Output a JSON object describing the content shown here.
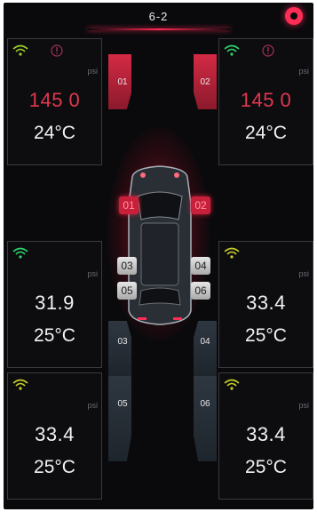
{
  "header": {
    "title": "6-2"
  },
  "tires": [
    {
      "id": "01",
      "pressure": "145 0",
      "unit": "psi",
      "temperature": "24°C",
      "alarm": true,
      "signal_color": "#9fd12a"
    },
    {
      "id": "02",
      "pressure": "145 0",
      "unit": "psi",
      "temperature": "24°C",
      "alarm": true,
      "signal_color": "#2fd46a"
    },
    {
      "id": "03",
      "pressure": "31.9",
      "unit": "psi",
      "temperature": "25°C",
      "alarm": false,
      "signal_color": "#2fd46a"
    },
    {
      "id": "04",
      "pressure": "33.4",
      "unit": "psi",
      "temperature": "25°C",
      "alarm": false,
      "signal_color": "#c9d02a"
    },
    {
      "id": "05",
      "pressure": "33.4",
      "unit": "psi",
      "temperature": "25°C",
      "alarm": false,
      "signal_color": "#c9d02a"
    },
    {
      "id": "06",
      "pressure": "33.4",
      "unit": "psi",
      "temperature": "25°C",
      "alarm": false,
      "signal_color": "#c9d02a"
    }
  ],
  "lanes": {
    "l1": "01",
    "l2": "02",
    "l3": "03",
    "l4": "04",
    "l5": "05",
    "l6": "06"
  },
  "sensors": {
    "s1": "01",
    "s2": "02",
    "s3": "03",
    "s4": "04",
    "s5": "05",
    "s6": "06"
  },
  "colors": {
    "accent": "#ff2d55",
    "alarm_text": "#e2374f",
    "background": "#0a0a0c"
  }
}
